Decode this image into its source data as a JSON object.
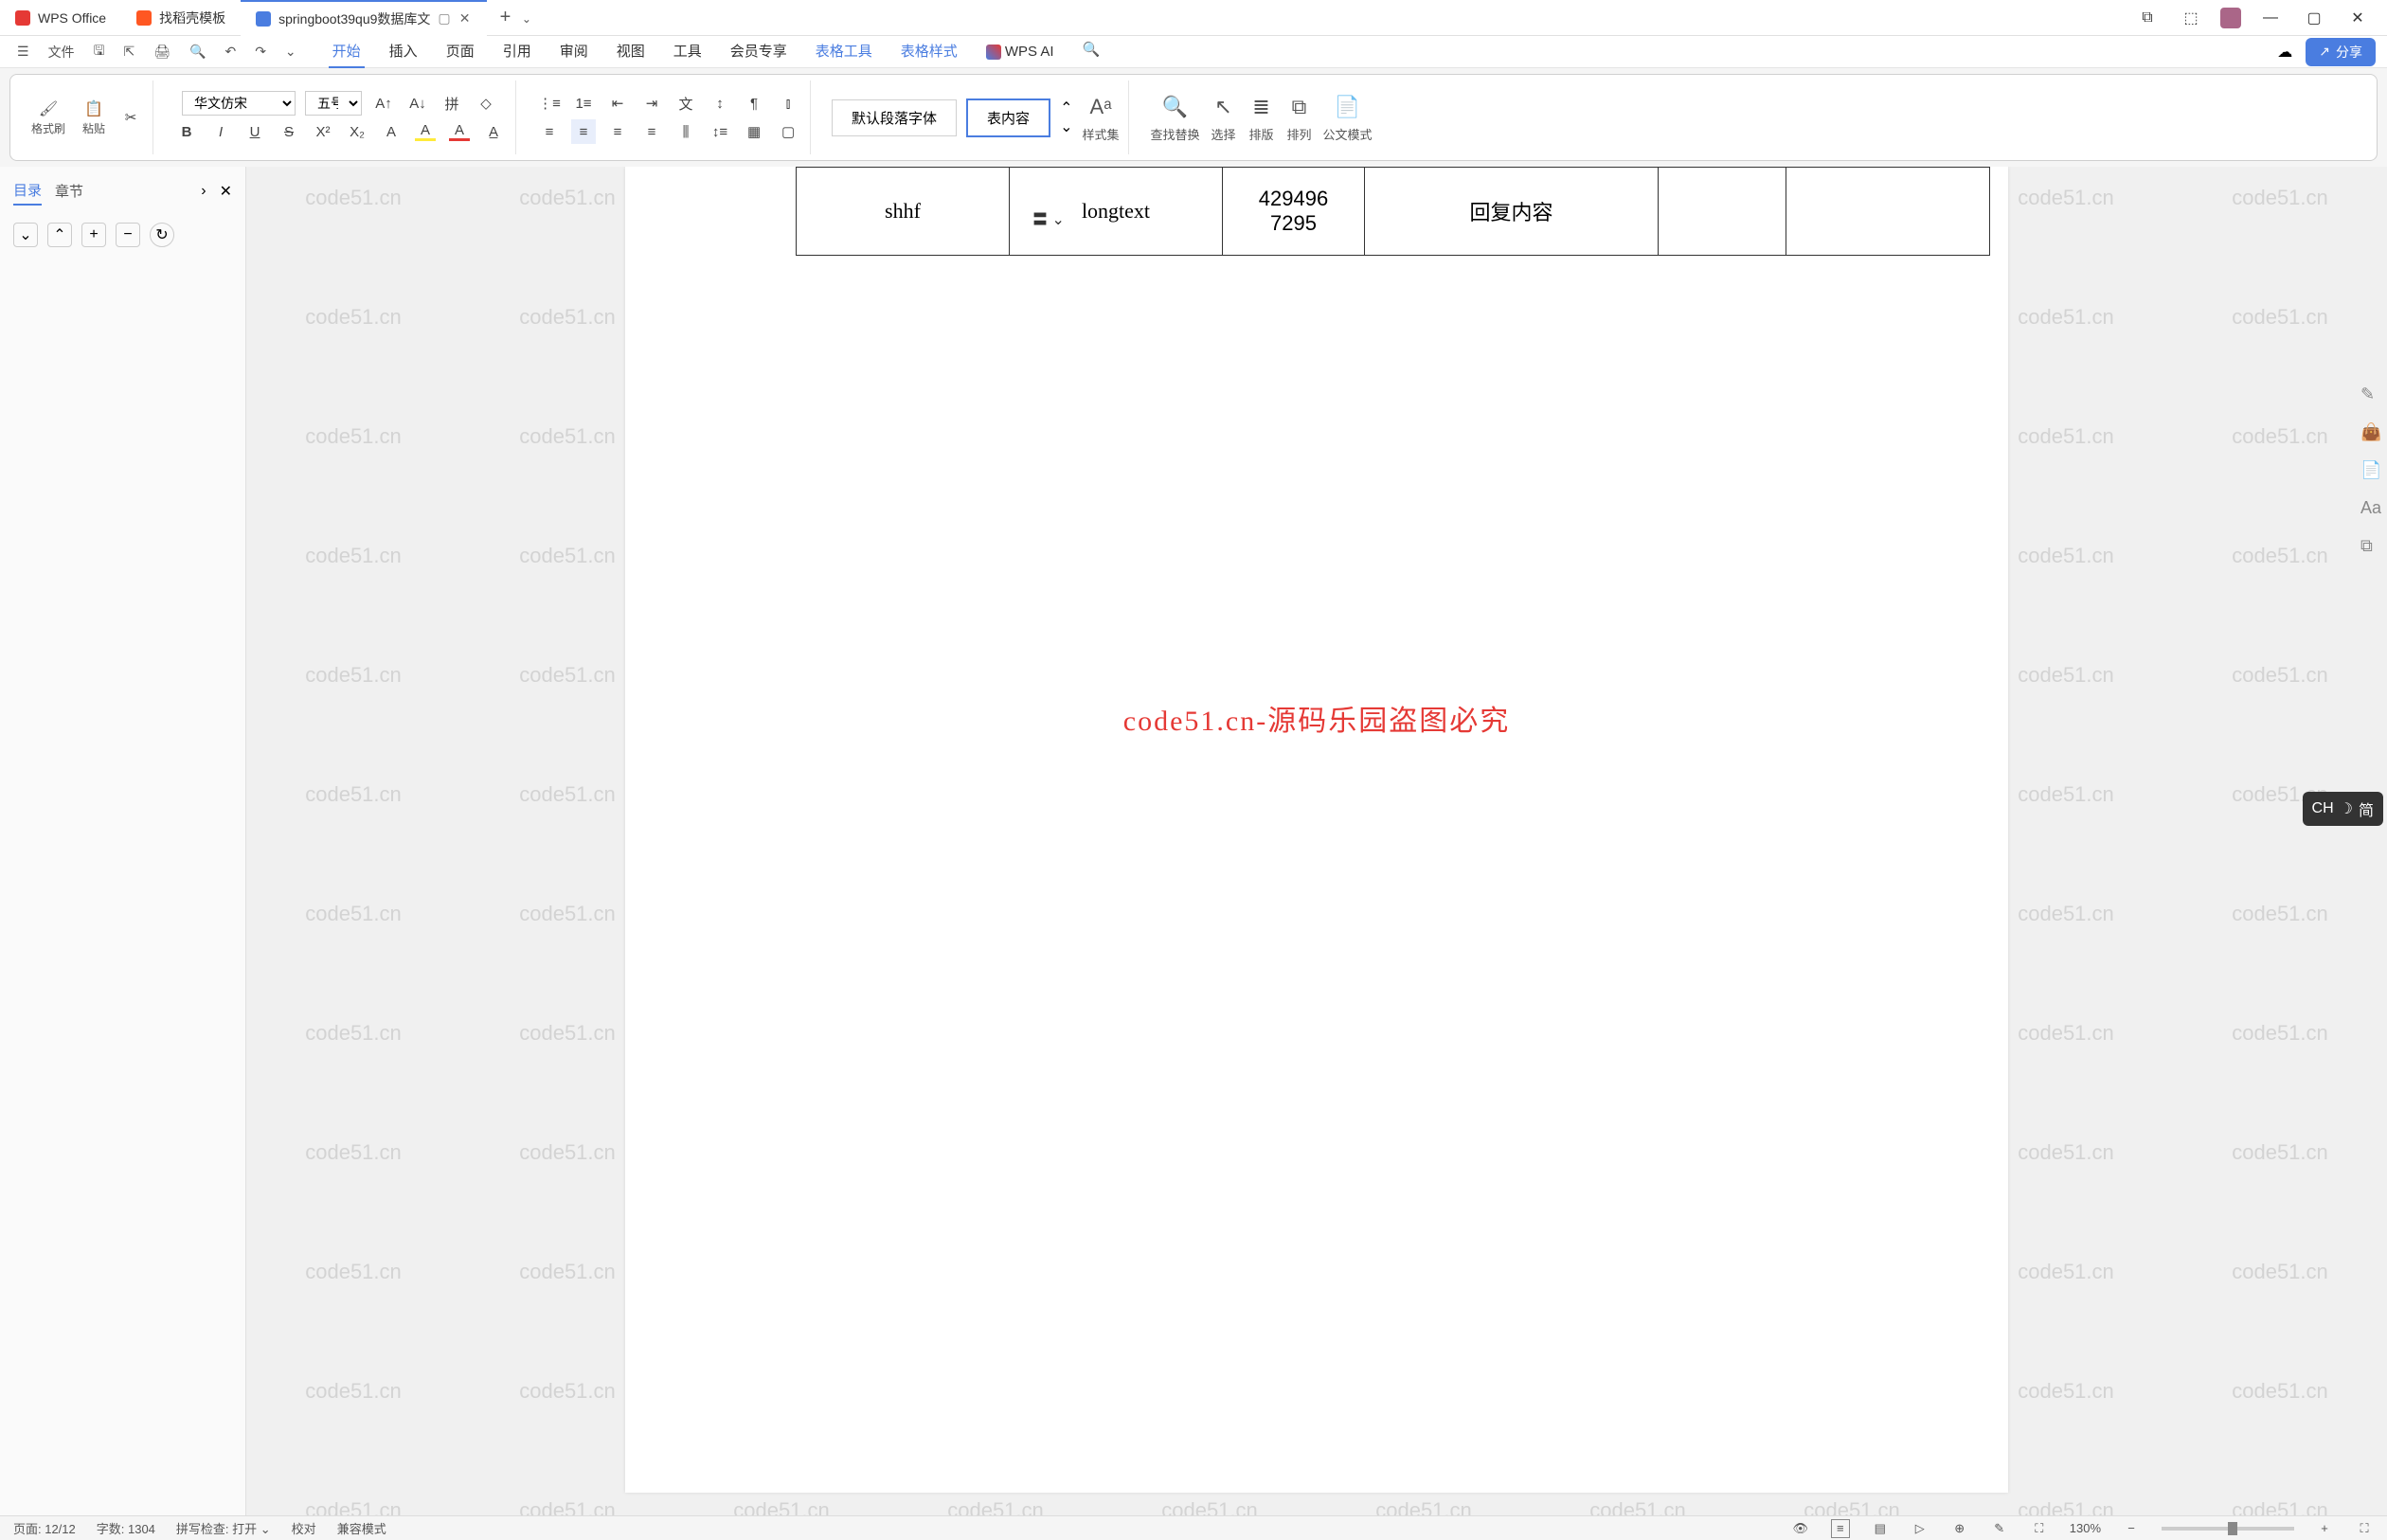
{
  "tabs": {
    "app": "WPS Office",
    "t1": "找稻壳模板",
    "t2": "springboot39qu9数据库文",
    "add": "+"
  },
  "qa": {
    "file": "文件"
  },
  "menu": {
    "start": "开始",
    "insert": "插入",
    "page": "页面",
    "ref": "引用",
    "review": "审阅",
    "view": "视图",
    "tool": "工具",
    "member": "会员专享",
    "tabletool": "表格工具",
    "tablestyle": "表格样式",
    "wpsai": "WPS AI"
  },
  "ribbon": {
    "formatbrush": "格式刷",
    "paste": "粘贴",
    "font": "华文仿宋",
    "size": "五号",
    "defaultfont": "默认段落字体",
    "tablecontent": "表内容",
    "styleset": "样式集",
    "findreplace": "查找替换",
    "select": "选择",
    "layout": "排版",
    "arrange": "排列",
    "docmode": "公文模式"
  },
  "leftpanel": {
    "mulu": "目录",
    "zhangjie": "章节"
  },
  "table": {
    "c1": "shhf",
    "c2": "longtext",
    "c3a": "429496",
    "c3b": "7295",
    "c4": "回复内容"
  },
  "ruler_marker": "〓",
  "centertext": "code51.cn-源码乐园盗图必究",
  "watermark": "code51.cn",
  "ime": {
    "lang": "CH",
    "mode": "简"
  },
  "status": {
    "page": "页面: 12/12",
    "words": "字数: 1304",
    "spell": "拼写检查: 打开",
    "proof": "校对",
    "compat": "兼容模式",
    "zoom": "130%"
  },
  "share": "分享"
}
